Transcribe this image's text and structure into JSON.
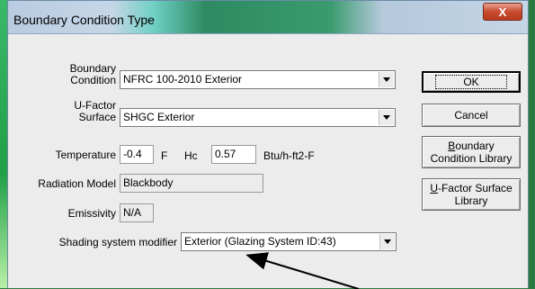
{
  "window": {
    "title": "Boundary Condition Type",
    "close_label": "X"
  },
  "form": {
    "boundary_condition": {
      "label_line1": "Boundary",
      "label_line2": "Condition",
      "value": "NFRC 100-2010 Exterior"
    },
    "ufactor_surface": {
      "label_line1": "U-Factor",
      "label_line2": "Surface",
      "value": "SHGC Exterior"
    },
    "temperature": {
      "label": "Temperature",
      "value": "-0.4",
      "unit": "F"
    },
    "hc": {
      "label": "Hc",
      "value": "0.57",
      "unit": "Btu/h-ft2-F"
    },
    "radiation_model": {
      "label": "Radiation Model",
      "value": "Blackbody"
    },
    "emissivity": {
      "label": "Emissivity",
      "value": "N/A"
    },
    "shading_modifier": {
      "label": "Shading system modifier",
      "value": "Exterior (Glazing System ID:43)"
    }
  },
  "buttons": {
    "ok": "OK",
    "cancel": "Cancel",
    "bc_library_line1_rest": "oundary",
    "bc_library_line1_accel": "B",
    "bc_library_line2": "Condition Library",
    "uf_library_line1_accel": "U",
    "uf_library_line1_rest": "-Factor Surface",
    "uf_library_line2": "Library"
  },
  "colors": {
    "dialog_bg": "#ececec",
    "close_button": "#c84c30",
    "desktop": "#2b7a3f"
  }
}
